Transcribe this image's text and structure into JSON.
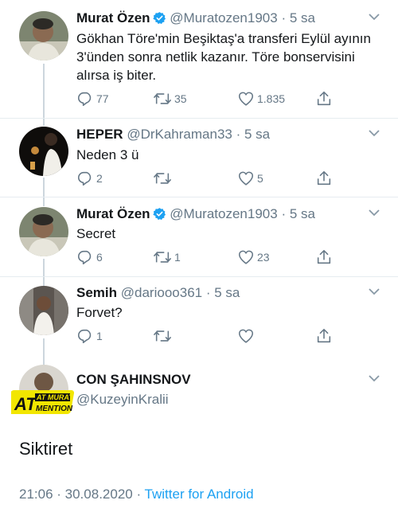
{
  "colors": {
    "accent": "#1da1f2",
    "muted": "#657786",
    "text": "#14171a",
    "line": "#ccd6dd"
  },
  "tweets": [
    {
      "name": "Murat Özen",
      "verified": true,
      "handle": "@Muratozen1903",
      "dot": "·",
      "time": "5 sa",
      "text": "Gökhan Töre'min Beşiktaş'a transferi Eylül ayının 3'ünden sonra netlik kazanır. Töre bonservisini alırsa iş biter.",
      "replies": "77",
      "retweets": "35",
      "likes": "1.835"
    },
    {
      "name": "HEPER",
      "verified": false,
      "handle": "@DrKahraman33",
      "dot": "·",
      "time": "5 sa",
      "text": "Neden 3 ü",
      "replies": "2",
      "retweets": "",
      "likes": "5"
    },
    {
      "name": "Murat Özen",
      "verified": true,
      "handle": "@Muratozen1903",
      "dot": "·",
      "time": "5 sa",
      "text": "Secret",
      "replies": "6",
      "retweets": "1",
      "likes": "23"
    },
    {
      "name": "Semih",
      "verified": false,
      "handle": "@dariooo361",
      "dot": "·",
      "time": "5 sa",
      "text": "Forvet?",
      "replies": "1",
      "retweets": "",
      "likes": ""
    }
  ],
  "main_tweet": {
    "name": "CON ŞAHINSNOV",
    "handle": "@KuzeyinKralii",
    "watermark": "AT MURAT MENTION",
    "text": "Siktiret",
    "time": "21:06 · 30.08.2020 ·",
    "client": "Twitter for Android"
  },
  "icons": {
    "reply": "reply-icon",
    "retweet": "retweet-icon",
    "like": "heart-icon",
    "share": "share-icon",
    "verified": "verified-badge-icon",
    "caret": "chevron-down-icon"
  }
}
